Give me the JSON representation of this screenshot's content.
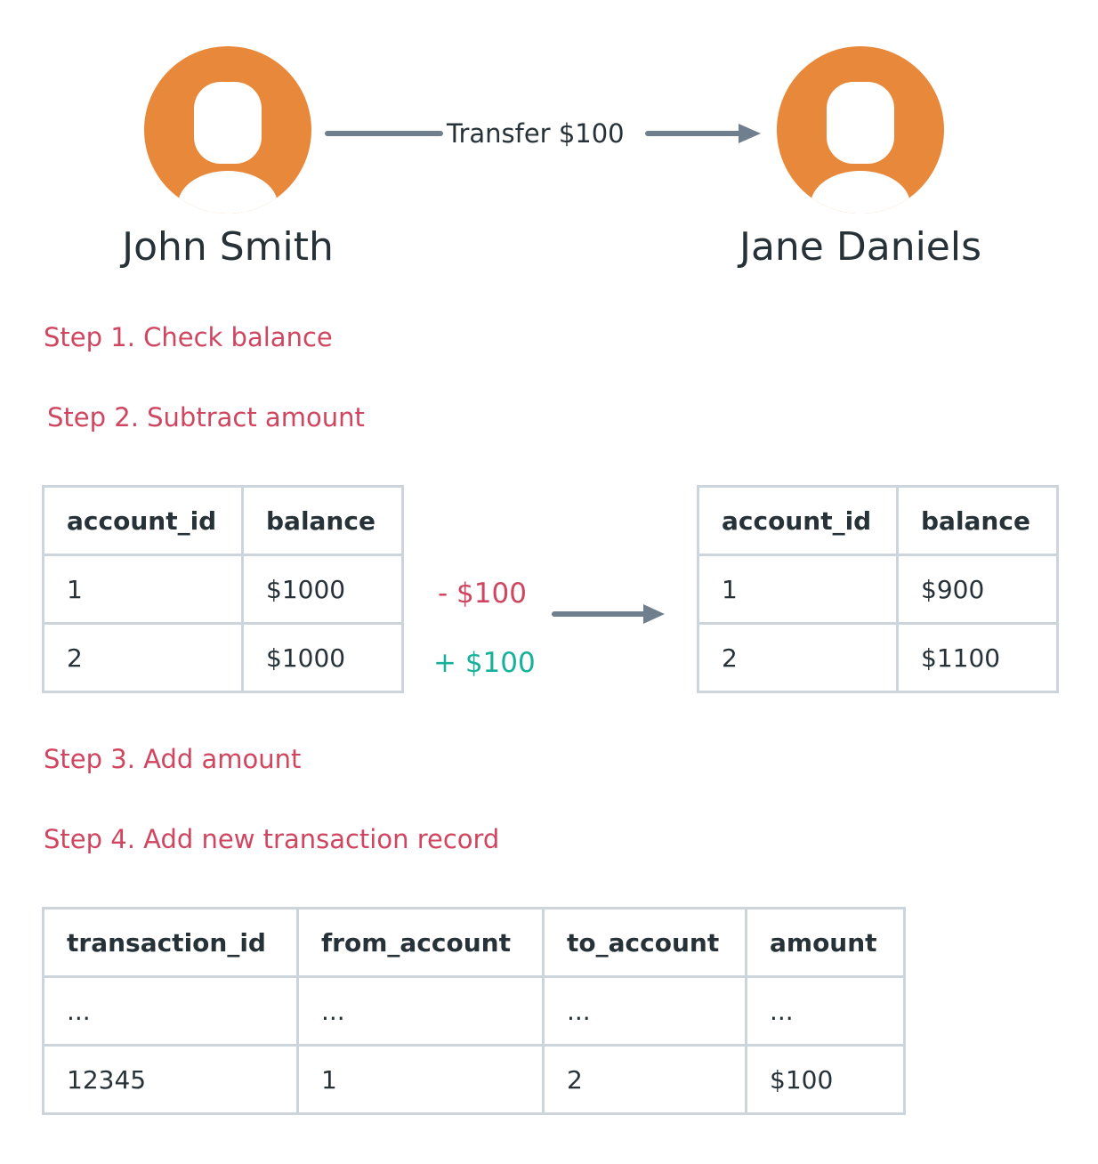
{
  "colors": {
    "avatar": "#e8883a",
    "arrow": "#6f7f8e",
    "step_text": "#d0455f",
    "minus": "#d0455f",
    "plus": "#17b09b",
    "table_border": "#ccd5dc",
    "text": "#263238"
  },
  "sender": {
    "name": "John Smith"
  },
  "receiver": {
    "name": "Jane Daniels"
  },
  "transfer": {
    "label": "Transfer $100"
  },
  "steps": [
    "Step 1. Check balance",
    "Step 2. Subtract amount",
    "Step 3. Add amount",
    "Step 4. Add new transaction record"
  ],
  "balances_before": {
    "headers": [
      "account_id",
      "balance"
    ],
    "rows": [
      [
        "1",
        "$1000"
      ],
      [
        "2",
        "$1000"
      ]
    ]
  },
  "operations": {
    "minus": "- $100",
    "plus": "+ $100"
  },
  "balances_after": {
    "headers": [
      "account_id",
      "balance"
    ],
    "rows": [
      [
        "1",
        "$900"
      ],
      [
        "2",
        "$1100"
      ]
    ]
  },
  "transactions": {
    "headers": [
      "transaction_id",
      "from_account",
      "to_account",
      "amount"
    ],
    "rows": [
      [
        "...",
        "...",
        "...",
        "..."
      ],
      [
        "12345",
        "1",
        "2",
        "$100"
      ]
    ]
  }
}
